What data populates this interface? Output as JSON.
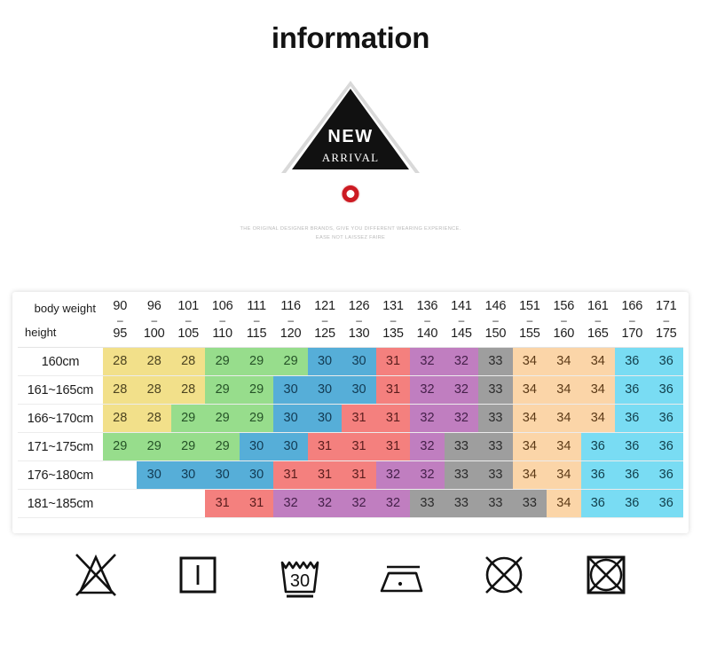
{
  "header": {
    "title": "information"
  },
  "logo": {
    "line1": "NEW",
    "line2": "ARRIVAL",
    "ring_color": "#cc1a22",
    "triangle_color": "#111111"
  },
  "tagline": {
    "text": "THE ORIGINAL DESIGNER BRANDS, GIVE YOU DIFFERENT WEARING EXPERIENCE. EASE NOT LAISSEZ FAIRE"
  },
  "size_table": {
    "corner": {
      "body_weight_label": "body weight",
      "height_label": "height"
    },
    "weight_columns": [
      {
        "from": "90",
        "to": "95"
      },
      {
        "from": "96",
        "to": "100"
      },
      {
        "from": "101",
        "to": "105"
      },
      {
        "from": "106",
        "to": "110"
      },
      {
        "from": "111",
        "to": "115"
      },
      {
        "from": "116",
        "to": "120"
      },
      {
        "from": "121",
        "to": "125"
      },
      {
        "from": "126",
        "to": "130"
      },
      {
        "from": "131",
        "to": "135"
      },
      {
        "from": "136",
        "to": "140"
      },
      {
        "from": "141",
        "to": "145"
      },
      {
        "from": "146",
        "to": "150"
      },
      {
        "from": "151",
        "to": "155"
      },
      {
        "from": "156",
        "to": "160"
      },
      {
        "from": "161",
        "to": "165"
      },
      {
        "from": "166",
        "to": "170"
      },
      {
        "from": "171",
        "to": "175"
      }
    ],
    "dash": "–",
    "rows": [
      {
        "height": "160cm",
        "values": [
          "28",
          "28",
          "28",
          "29",
          "29",
          "29",
          "30",
          "30",
          "31",
          "32",
          "32",
          "33",
          "34",
          "34",
          "34",
          "36",
          "36"
        ]
      },
      {
        "height": "161~165cm",
        "values": [
          "28",
          "28",
          "28",
          "29",
          "29",
          "30",
          "30",
          "30",
          "31",
          "32",
          "32",
          "33",
          "34",
          "34",
          "34",
          "36",
          "36"
        ]
      },
      {
        "height": "166~170cm",
        "values": [
          "28",
          "28",
          "29",
          "29",
          "29",
          "30",
          "30",
          "31",
          "31",
          "32",
          "32",
          "33",
          "34",
          "34",
          "34",
          "36",
          "36"
        ]
      },
      {
        "height": "171~175cm",
        "values": [
          "29",
          "29",
          "29",
          "29",
          "30",
          "30",
          "31",
          "31",
          "31",
          "32",
          "33",
          "33",
          "34",
          "34",
          "36",
          "36",
          "36"
        ]
      },
      {
        "height": "176~180cm",
        "values": [
          "",
          "30",
          "30",
          "30",
          "30",
          "31",
          "31",
          "31",
          "32",
          "32",
          "33",
          "33",
          "34",
          "34",
          "36",
          "36",
          "36"
        ]
      },
      {
        "height": "181~185cm",
        "values": [
          "",
          "",
          "31",
          "31",
          "32",
          "32",
          "32",
          "32",
          "33",
          "33",
          "33",
          "33",
          "34",
          "36",
          "36",
          "36"
        ]
      }
    ],
    "value_colors": {
      "28": {
        "bg": "#f2e08a",
        "fg": "#4d4420"
      },
      "29": {
        "bg": "#97dd8c",
        "fg": "#255227"
      },
      "30": {
        "bg": "#56aed8",
        "fg": "#123a52"
      },
      "31": {
        "bg": "#f4807e",
        "fg": "#5a1d1d"
      },
      "32": {
        "bg": "#c07ec0",
        "fg": "#45204a"
      },
      "33": {
        "bg": "#9e9e9e",
        "fg": "#2b2b2b"
      },
      "34": {
        "bg": "#fbd5a8",
        "fg": "#5c3a17"
      },
      "36": {
        "bg": "#79dcf3",
        "fg": "#12404d"
      }
    }
  },
  "care_symbols": [
    {
      "name": "do-not-bleach-icon",
      "label": "Do not bleach"
    },
    {
      "name": "tumble-dry-icon",
      "label": "Drip dry"
    },
    {
      "name": "machine-wash-30-icon",
      "label": "Machine wash 30",
      "temperature": "30"
    },
    {
      "name": "iron-low-icon",
      "label": "Iron low heat"
    },
    {
      "name": "do-not-dry-clean-icon",
      "label": "Do not dry clean"
    },
    {
      "name": "do-not-tumble-dry-icon",
      "label": "Do not tumble dry"
    }
  ]
}
